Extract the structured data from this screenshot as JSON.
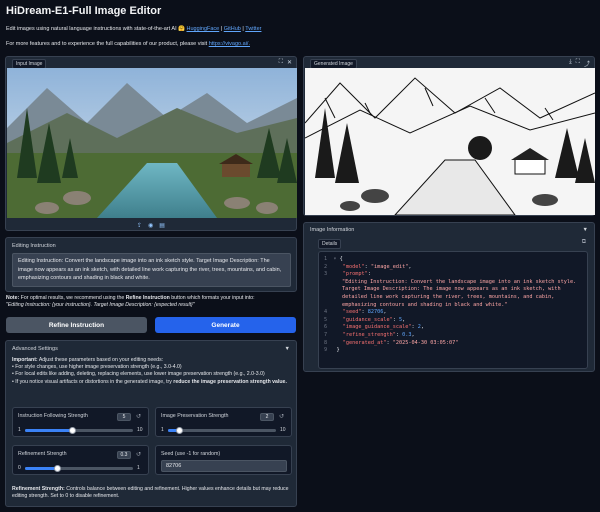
{
  "header": {
    "title": "HiDream-E1-Full Image Editor",
    "intro_text": "Edit images using natural language instructions with state-of-the-art AI",
    "intro_emoji": "🤗",
    "link_huggingface": "HuggingFace",
    "link_github": "GitHub",
    "link_twitter": "Twitter",
    "sep": "|",
    "features_text": "For more features and to experience the full capabilities of our product, please visit",
    "features_link": "https://vivago.ai/."
  },
  "input_panel": {
    "label": "Input Image",
    "icons": [
      "maximize-icon",
      "close-icon"
    ],
    "bottom_icons": [
      "upload-icon",
      "webcam-icon",
      "clipboard-icon"
    ]
  },
  "output_panel": {
    "label": "Generated Image",
    "icons": [
      "download-icon",
      "maximize-icon",
      "share-icon"
    ]
  },
  "instruction": {
    "label": "Editing Instruction",
    "value": "Editing Instruction: Convert the landscape image into an ink sketch style. Target Image Description: The image now appears as an ink sketch, with detailed line work capturing the river, trees, mountains, and cabin, emphasizing contours and shading in black and white."
  },
  "note": {
    "bold": "Note:",
    "text1": "For optimal results, we recommend using the",
    "bold2": "Refine Instruction",
    "text2": "button which formats your input into:",
    "italic": "\"Editing Instruction: {your instruction}. Target Image Description: {expected result}\""
  },
  "buttons": {
    "refine": "Refine Instruction",
    "generate": "Generate"
  },
  "advanced": {
    "title": "Advanced Settings",
    "chevron": "▼",
    "important_bold": "Important:",
    "important_text": "Adjust these parameters based on your editing needs:",
    "bullets": [
      "For style changes, use higher image preservation strength (e.g., 3.0-4.0)",
      "For local edits like adding, deleting, replacing elements, use lower image preservation strength (e.g., 2.0-3.0)"
    ],
    "bullet3_text": "If you notice visual artifacts or distortions in the generated image, try",
    "bullet3_bold": "reduce the image preservation strength value.",
    "sliders": {
      "instruction_following": {
        "label": "Instruction Following Strength",
        "value": "5",
        "min": "1",
        "max": "10",
        "fraction": 0.44
      },
      "image_preservation": {
        "label": "Image Preservation Strength",
        "value": "2",
        "min": "1",
        "max": "10",
        "fraction": 0.11
      },
      "refinement": {
        "label": "Refinement Strength",
        "value": "0.3",
        "min": "0",
        "max": "1",
        "fraction": 0.3
      }
    },
    "seed": {
      "label": "Seed (use -1 for random)",
      "value": "82706"
    },
    "footer_bold": "Refinement Strength:",
    "footer_text": "Controls balance between editing and refinement. Higher values enhance details but may reduce editing strength. Set to 0 to disable refinement."
  },
  "info": {
    "title": "Image Information",
    "chevron": "▼",
    "tab": "Details",
    "json_lines": {
      "open": "{",
      "model_key": "\"model\"",
      "model_val": "\"image_edit\"",
      "prompt_key": "\"prompt\"",
      "prompt_val": "\"Editing Instruction: Convert the landscape image into an ink sketch style. Target Image Description: The image now appears as an ink sketch, with detailed line work capturing the river, trees, mountains, and cabin, emphasizing contours and shading in black and white.\"",
      "seed_key": "\"seed\"",
      "seed_val": "82706",
      "gs_key": "\"guidance_scale\"",
      "gs_val": "5",
      "igs_key": "\"image_guidance_scale\"",
      "igs_val": "2",
      "rs_key": "\"refine_strength\"",
      "rs_val": "0.3",
      "ga_key": "\"generated_at\"",
      "ga_val": "\"2025-04-30 03:05:07\"",
      "close": "}"
    }
  }
}
